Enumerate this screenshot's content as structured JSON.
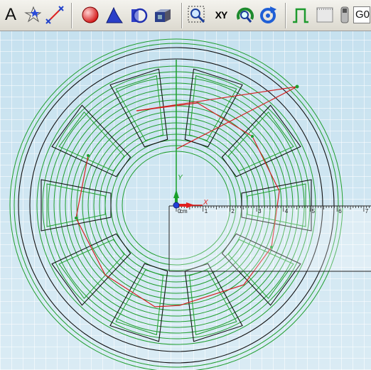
{
  "toolbar": {
    "text_tool_label": "A",
    "view_xy_label": "XY",
    "grid_snap_value": "G0",
    "icons": [
      "text-icon",
      "point-icon",
      "line-icon",
      "sphere-icon",
      "extrude-icon",
      "revolve-icon",
      "block-icon",
      "zoom-box-icon",
      "view-xy-icon",
      "rotate-view-icon",
      "refresh-icon",
      "pulse-icon",
      "grid-icon",
      "coil-icon"
    ]
  },
  "viewport": {
    "background_color": "#c6e1ef",
    "geometry_color": "#111111",
    "coil_color": "#1f9e2e",
    "path_color": "#d42020",
    "axes": {
      "x_label": "X",
      "y_label": "Y",
      "x_color": "#e02020",
      "y_color": "#1aa02a"
    },
    "ruler": {
      "unit": "cm",
      "ticks": [
        "0",
        "1",
        "2",
        "3",
        "4",
        "5",
        "6",
        "7"
      ]
    }
  }
}
